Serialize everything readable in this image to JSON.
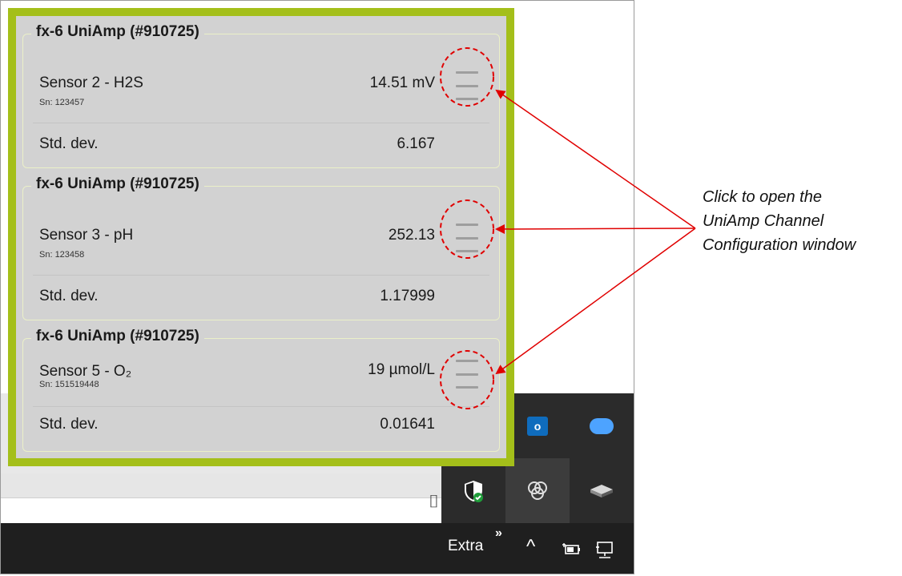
{
  "panel": {
    "groups": [
      {
        "title": "fx-6 UniAmp (#910725)",
        "sensor_name": "Sensor 2 - H2S",
        "serial": "Sn: 123457",
        "value": "14.51 mV",
        "std_label": "Std. dev.",
        "std_value": "6.167"
      },
      {
        "title": "fx-6 UniAmp (#910725)",
        "sensor_name": "Sensor 3 - pH",
        "serial": "Sn: 123458",
        "value": "252.13",
        "std_label": "Std. dev.",
        "std_value": "1.17999"
      },
      {
        "title": "fx-6 UniAmp (#910725)",
        "sensor_name": "Sensor 5 - O₂",
        "serial": "Sn: 151519448",
        "value": "19 µmol/L",
        "std_label": "Std. dev.",
        "std_value": "0.01641"
      }
    ],
    "accent_color": "#a4bf1a"
  },
  "tray": {
    "icons": [
      "outlook-icon",
      "cloud-icon",
      "shield-icon",
      "uniamp-icon",
      "device-icon"
    ]
  },
  "taskbar": {
    "extra_label": "Extra",
    "overflow_glyph": "»",
    "caret_glyph": "^"
  },
  "annotation": {
    "callout_text": "Click to open the UniAmp Channel Configuration window",
    "callout_lines": [
      "Click to open the",
      "UniAmp Channel",
      "Configuration window"
    ],
    "highlight_color": "#e00000"
  }
}
